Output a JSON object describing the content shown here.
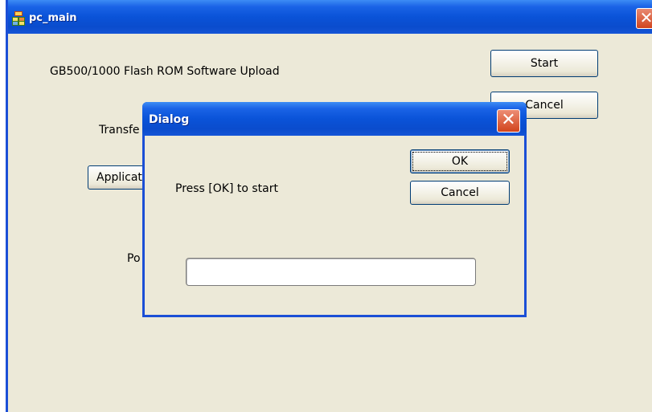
{
  "main_window": {
    "title": "pc_main",
    "close_glyph": "✕",
    "heading": "GB500/1000 Flash ROM Software Upload",
    "transfer_label": "Transfe",
    "port_label": "Po",
    "start_button": "Start",
    "cancel_button": "Cancel",
    "application_button": "Applicat"
  },
  "dialog": {
    "title": "Dialog",
    "close_glyph": "✕",
    "message": "Press [OK] to start",
    "ok_button": "OK",
    "cancel_button": "Cancel",
    "progress": 0
  },
  "colors": {
    "titlebar": "#0a53d8",
    "window_bg": "#ece9d8",
    "close_button": "#d2441c"
  },
  "icons": {
    "app_icon": "application-icon",
    "close_icon": "close-icon"
  }
}
